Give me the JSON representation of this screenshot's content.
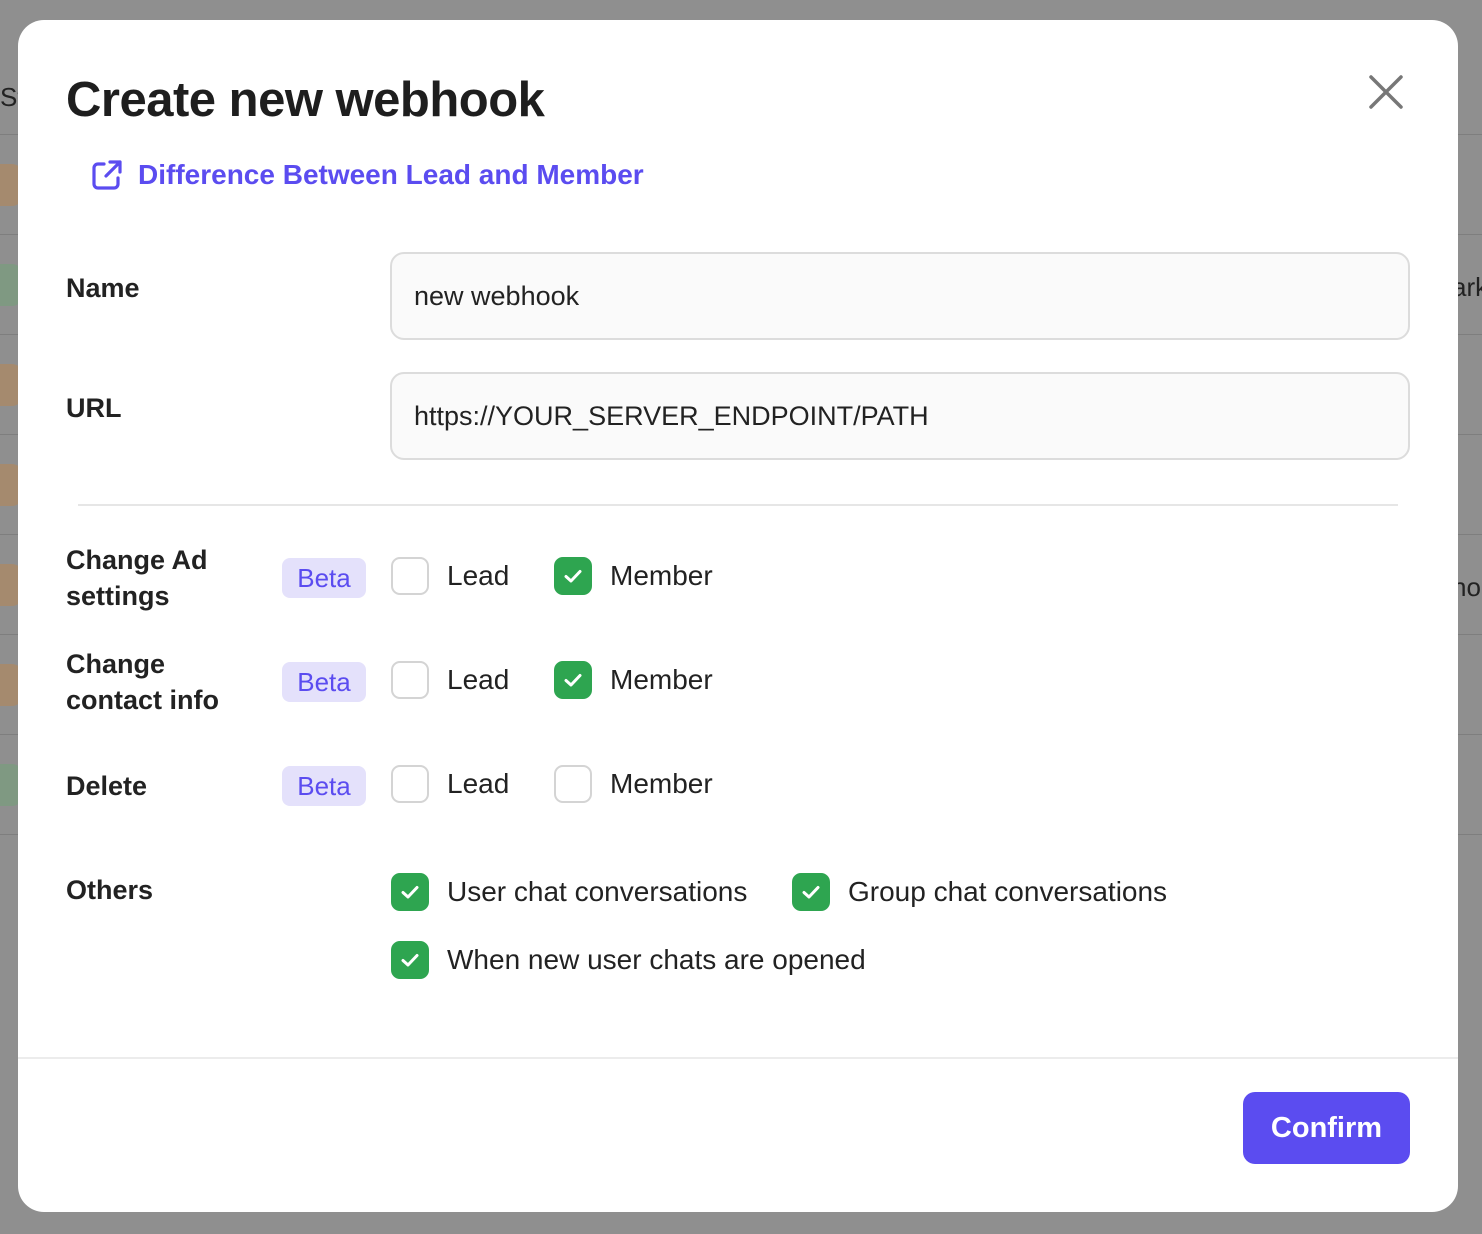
{
  "modal": {
    "title": "Create new webhook",
    "help_link": "Difference Between Lead and Member",
    "name_label": "Name",
    "name_value": "new webhook",
    "url_label": "URL",
    "url_value": "https://YOUR_SERVER_ENDPOINT/PATH",
    "rows": [
      {
        "label_line1": "Change Ad",
        "label_line2": "settings",
        "badge": "Beta",
        "lead_label": "Lead",
        "lead_checked": false,
        "member_label": "Member",
        "member_checked": true
      },
      {
        "label_line1": "Change",
        "label_line2": "contact info",
        "badge": "Beta",
        "lead_label": "Lead",
        "lead_checked": false,
        "member_label": "Member",
        "member_checked": true
      },
      {
        "label_line1": "Delete",
        "label_line2": "",
        "badge": "Beta",
        "lead_label": "Lead",
        "lead_checked": false,
        "member_label": "Member",
        "member_checked": false
      }
    ],
    "others_label": "Others",
    "others": [
      {
        "label": "User chat conversations",
        "checked": true
      },
      {
        "label": "Group chat conversations",
        "checked": true
      },
      {
        "label": "When new user chats are opened",
        "checked": true
      }
    ],
    "confirm_label": "Confirm"
  },
  "background": {
    "edge_texts": [
      "St",
      "ark",
      "no"
    ]
  },
  "colors": {
    "accent": "#5b4cf0",
    "check_green": "#2ea550",
    "beta_bg": "#e4e1fb"
  }
}
